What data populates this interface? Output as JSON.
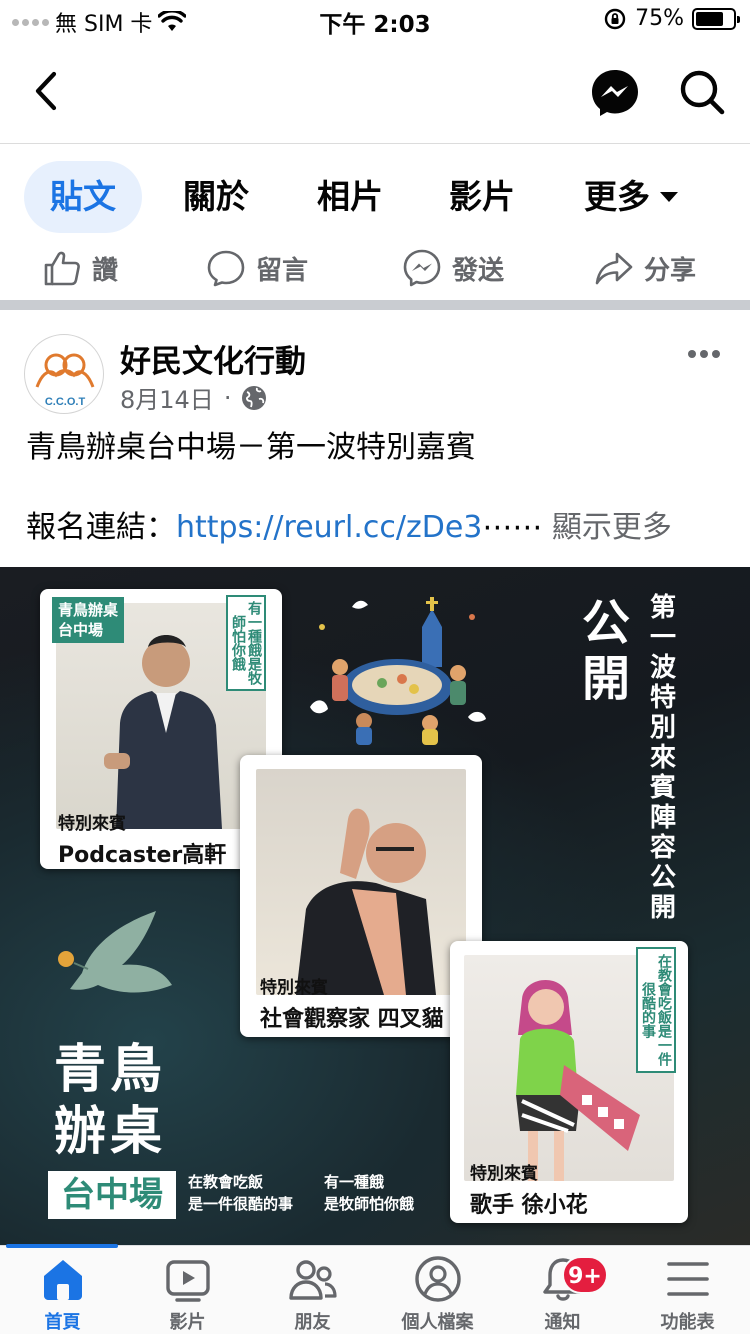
{
  "status_bar": {
    "carrier": "無 SIM 卡",
    "time": "下午 2:03",
    "battery_text": "75%",
    "battery_level": 0.75
  },
  "nav": {
    "icons": [
      "back-icon",
      "messenger-icon",
      "search-icon"
    ]
  },
  "tabs": [
    {
      "label": "貼文",
      "active": true
    },
    {
      "label": "關於",
      "active": false
    },
    {
      "label": "相片",
      "active": false
    },
    {
      "label": "影片",
      "active": false
    },
    {
      "label": "更多",
      "active": false
    }
  ],
  "actions": [
    {
      "label": "讚",
      "icon": "thumbs-up-icon"
    },
    {
      "label": "留言",
      "icon": "comment-icon"
    },
    {
      "label": "發送",
      "icon": "messenger-icon"
    },
    {
      "label": "分享",
      "icon": "share-icon"
    }
  ],
  "post": {
    "page_name": "好民文化行動",
    "avatar_text": "C.C.O.T",
    "date": "8月14日",
    "dot": "·",
    "text_line1": "青鳥辦桌台中場－第一波特別嘉賓",
    "link_label": "報名連結：",
    "link": "https://reurl.cc/zDe3",
    "ellipsis": "⋯⋯",
    "see_more": "顯示更多"
  },
  "image": {
    "headline_big": "公開",
    "headline_vertical": "第一波特別來賓陣容公開",
    "event_title": "青鳥辦桌",
    "event_city": "台中場",
    "taglines": [
      "在教會吃飯\n是一件很酷的事",
      "有一種餓\n是牧師怕你餓"
    ],
    "cards": [
      {
        "tag": "青鳥辦桌\n台中場",
        "vtag": "有一種餓是牧師怕你餓",
        "label": "特別來賓",
        "name": "Podcaster高軒"
      },
      {
        "label": "特別來賓",
        "name": "社會觀察家 四叉貓"
      },
      {
        "vtag": "在教會吃飯是一件很酷的事",
        "label": "特別來賓",
        "name": "歌手 徐小花"
      }
    ]
  },
  "tabbar": [
    {
      "label": "首頁",
      "icon": "home-icon",
      "active": true
    },
    {
      "label": "影片",
      "icon": "video-icon",
      "active": false
    },
    {
      "label": "朋友",
      "icon": "friends-icon",
      "active": false
    },
    {
      "label": "個人檔案",
      "icon": "profile-icon",
      "active": false
    },
    {
      "label": "通知",
      "icon": "bell-icon",
      "active": false,
      "badge": "9+"
    },
    {
      "label": "功能表",
      "icon": "menu-icon",
      "active": false
    }
  ],
  "colors": {
    "accent": "#1b74e4",
    "link": "#2373c9",
    "badge": "#e41e3f",
    "teal": "#2e8b77"
  }
}
